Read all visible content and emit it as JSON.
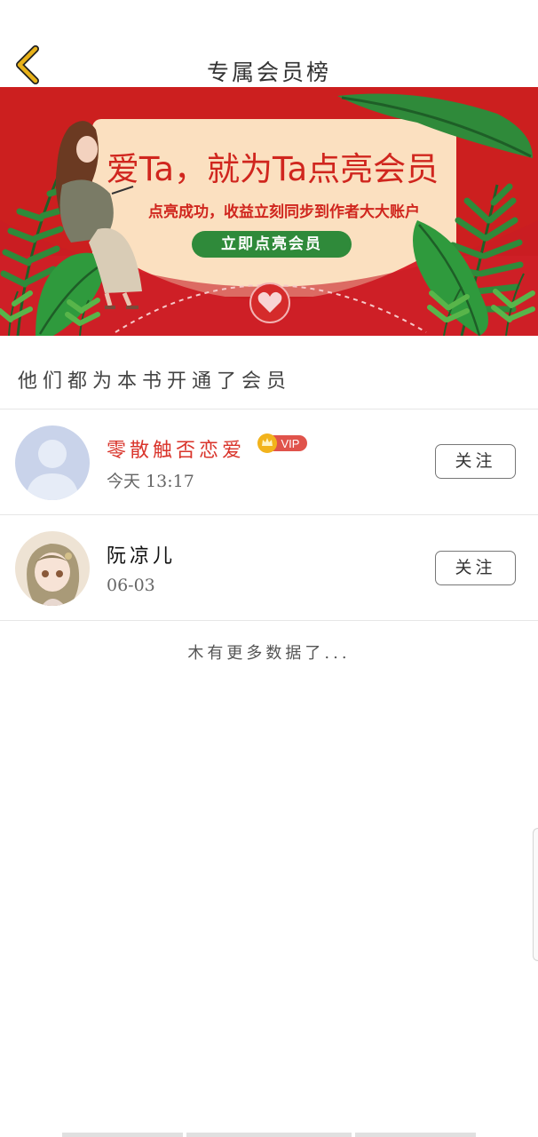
{
  "header": {
    "title": "专属会员榜"
  },
  "banner": {
    "title": "爱Ta，就为Ta点亮会员",
    "subtitle": "点亮成功，收益立刻同步到作者大大账户",
    "cta_label": "立即点亮会员"
  },
  "section": {
    "label": "他们都为本书开通了会员"
  },
  "members": [
    {
      "name": "零散触否恋爱",
      "badge": "VIP",
      "time": "今天 13:17",
      "follow_label": "关注",
      "name_color": "#d9342b"
    },
    {
      "name": "阮凉儿",
      "badge": "",
      "time": "06-03",
      "follow_label": "关注",
      "name_color": "#111111"
    }
  ],
  "footer": {
    "no_more": "木有更多数据了..."
  },
  "colors": {
    "banner_red": "#cc1f1f",
    "accent_green": "#2f8a3a",
    "back_arrow_yellow": "#e8b21a"
  }
}
